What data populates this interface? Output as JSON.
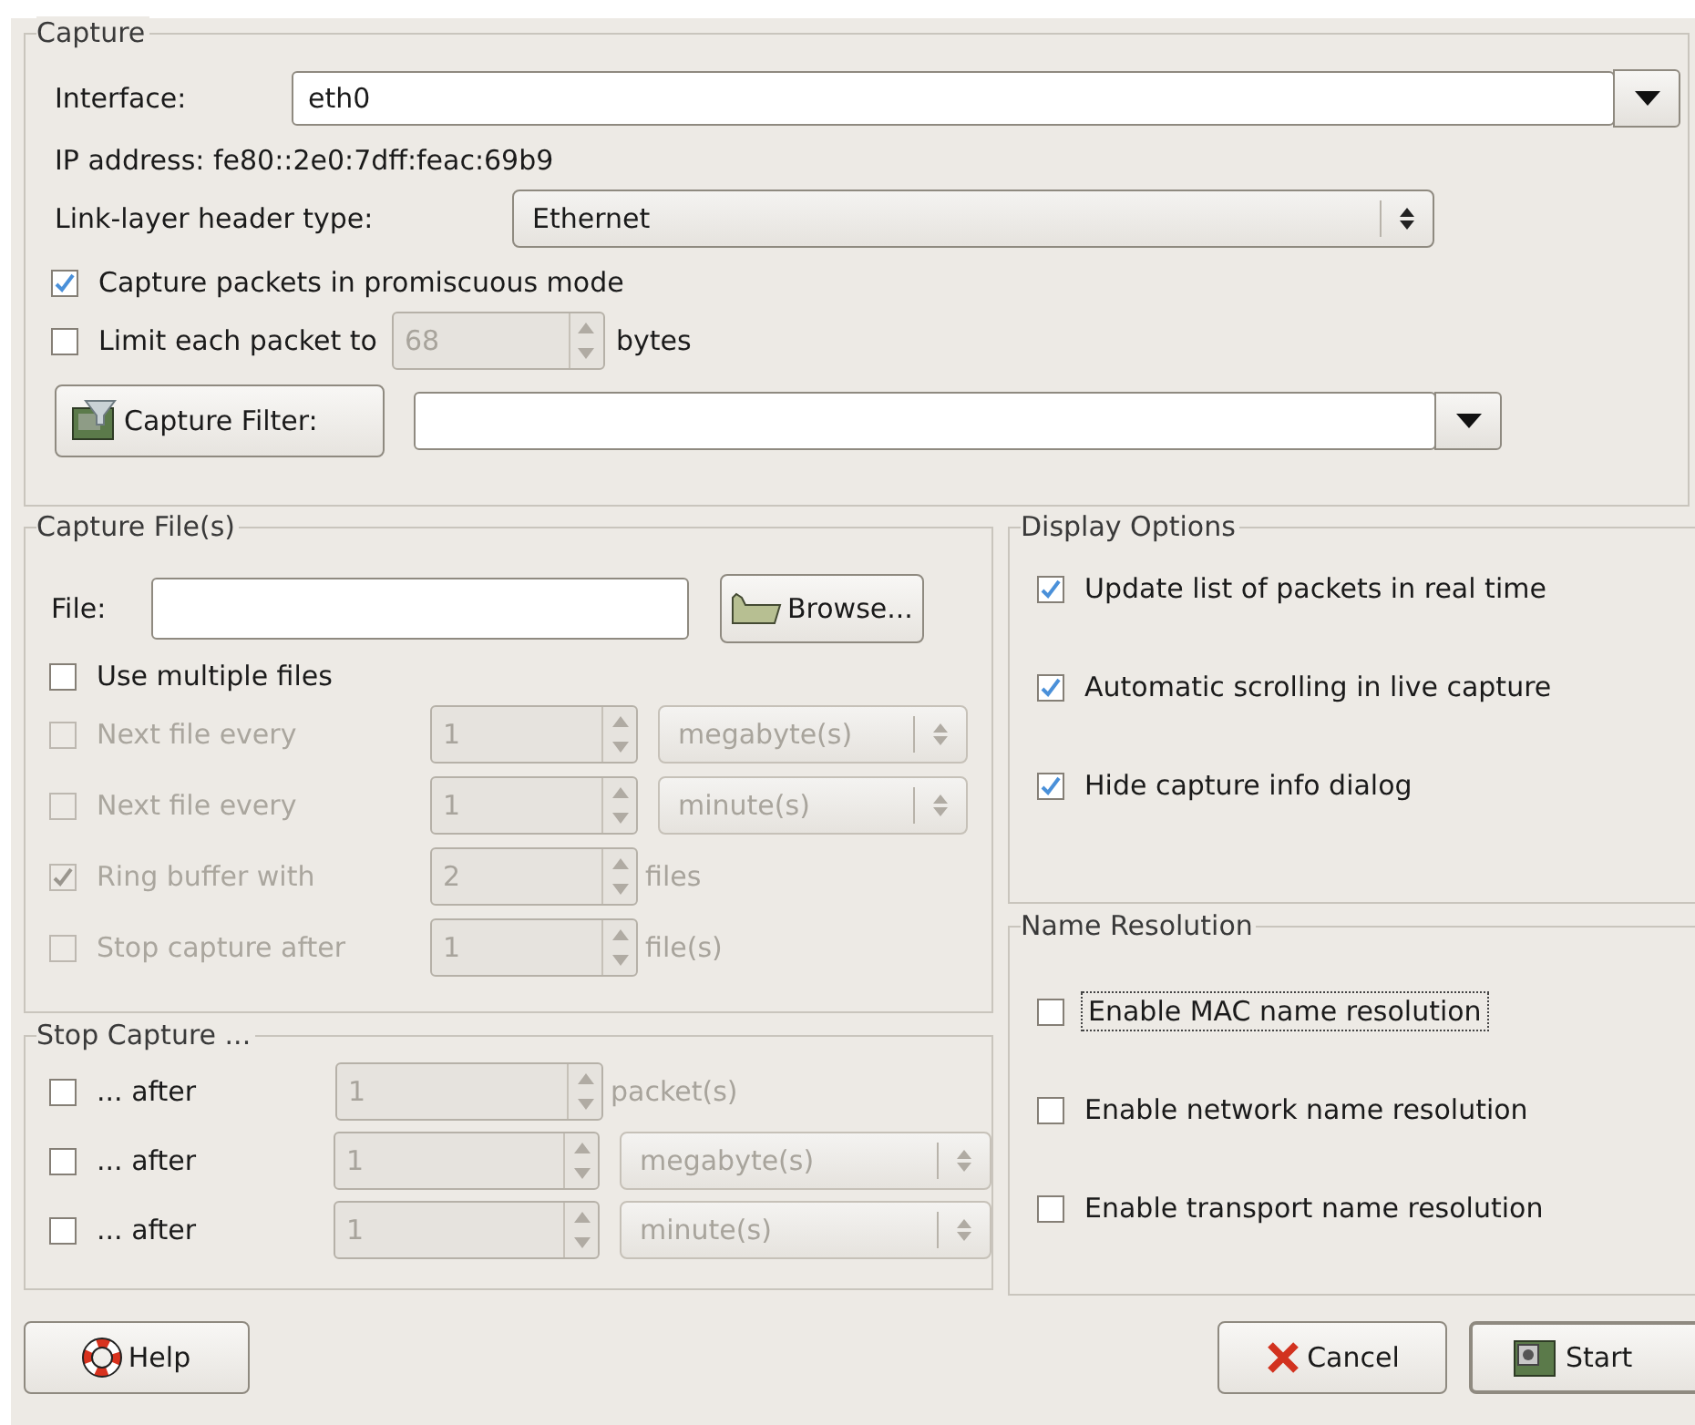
{
  "capture": {
    "title": "Capture",
    "interface": {
      "label": "Interface:",
      "value": "eth0"
    },
    "ip_address": "IP address: fe80::2e0:7dff:feac:69b9",
    "link_layer": {
      "label": "Link-layer header type:",
      "value": "Ethernet"
    },
    "promiscuous": {
      "label": "Capture packets in promiscuous mode",
      "checked": true
    },
    "limit": {
      "label": "Limit each packet to",
      "checked": false,
      "value": "68",
      "unit": "bytes",
      "field_disabled": true
    },
    "filter": {
      "button": "Capture Filter:"
    }
  },
  "capture_files": {
    "title": "Capture File(s)",
    "file_label": "File:",
    "browse": "Browse...",
    "multiple": {
      "label": "Use multiple files",
      "checked": false
    },
    "rows": [
      {
        "label": "Next file every",
        "checked": false,
        "disabled": true,
        "field_disabled": true,
        "value": "1",
        "unit": "megabyte(s)",
        "kind": "select"
      },
      {
        "label": "Next file every",
        "checked": false,
        "disabled": true,
        "field_disabled": true,
        "value": "1",
        "unit": "minute(s)",
        "kind": "select"
      },
      {
        "label": "Ring buffer with",
        "checked": true,
        "disabled": true,
        "field_disabled": true,
        "value": "2",
        "unit": "files",
        "kind": "text"
      },
      {
        "label": "Stop capture after",
        "checked": false,
        "disabled": true,
        "field_disabled": true,
        "value": "1",
        "unit": "file(s)",
        "kind": "text"
      }
    ]
  },
  "stop_capture": {
    "title": "Stop Capture ...",
    "rows": [
      {
        "label": "... after",
        "checked": false,
        "disabled": false,
        "field_disabled": true,
        "value": "1",
        "unit": "packet(s)",
        "kind": "text"
      },
      {
        "label": "... after",
        "checked": false,
        "disabled": false,
        "field_disabled": true,
        "value": "1",
        "unit": "megabyte(s)",
        "kind": "select"
      },
      {
        "label": "... after",
        "checked": false,
        "disabled": false,
        "field_disabled": true,
        "value": "1",
        "unit": "minute(s)",
        "kind": "select"
      }
    ]
  },
  "display_options": {
    "title": "Display Options",
    "items": [
      {
        "label": "Update list of packets in real time",
        "checked": true,
        "focused": false
      },
      {
        "label": "Automatic scrolling in live capture",
        "checked": true,
        "focused": false
      },
      {
        "label": "Hide capture info dialog",
        "checked": true,
        "focused": false
      }
    ]
  },
  "name_resolution": {
    "title": "Name Resolution",
    "items": [
      {
        "label": "Enable MAC name resolution",
        "checked": false,
        "focused": true
      },
      {
        "label": "Enable network name resolution",
        "checked": false,
        "focused": false
      },
      {
        "label": "Enable transport name resolution",
        "checked": false,
        "focused": false
      }
    ]
  },
  "buttons": {
    "help": "Help",
    "cancel": "Cancel",
    "start": "Start"
  }
}
